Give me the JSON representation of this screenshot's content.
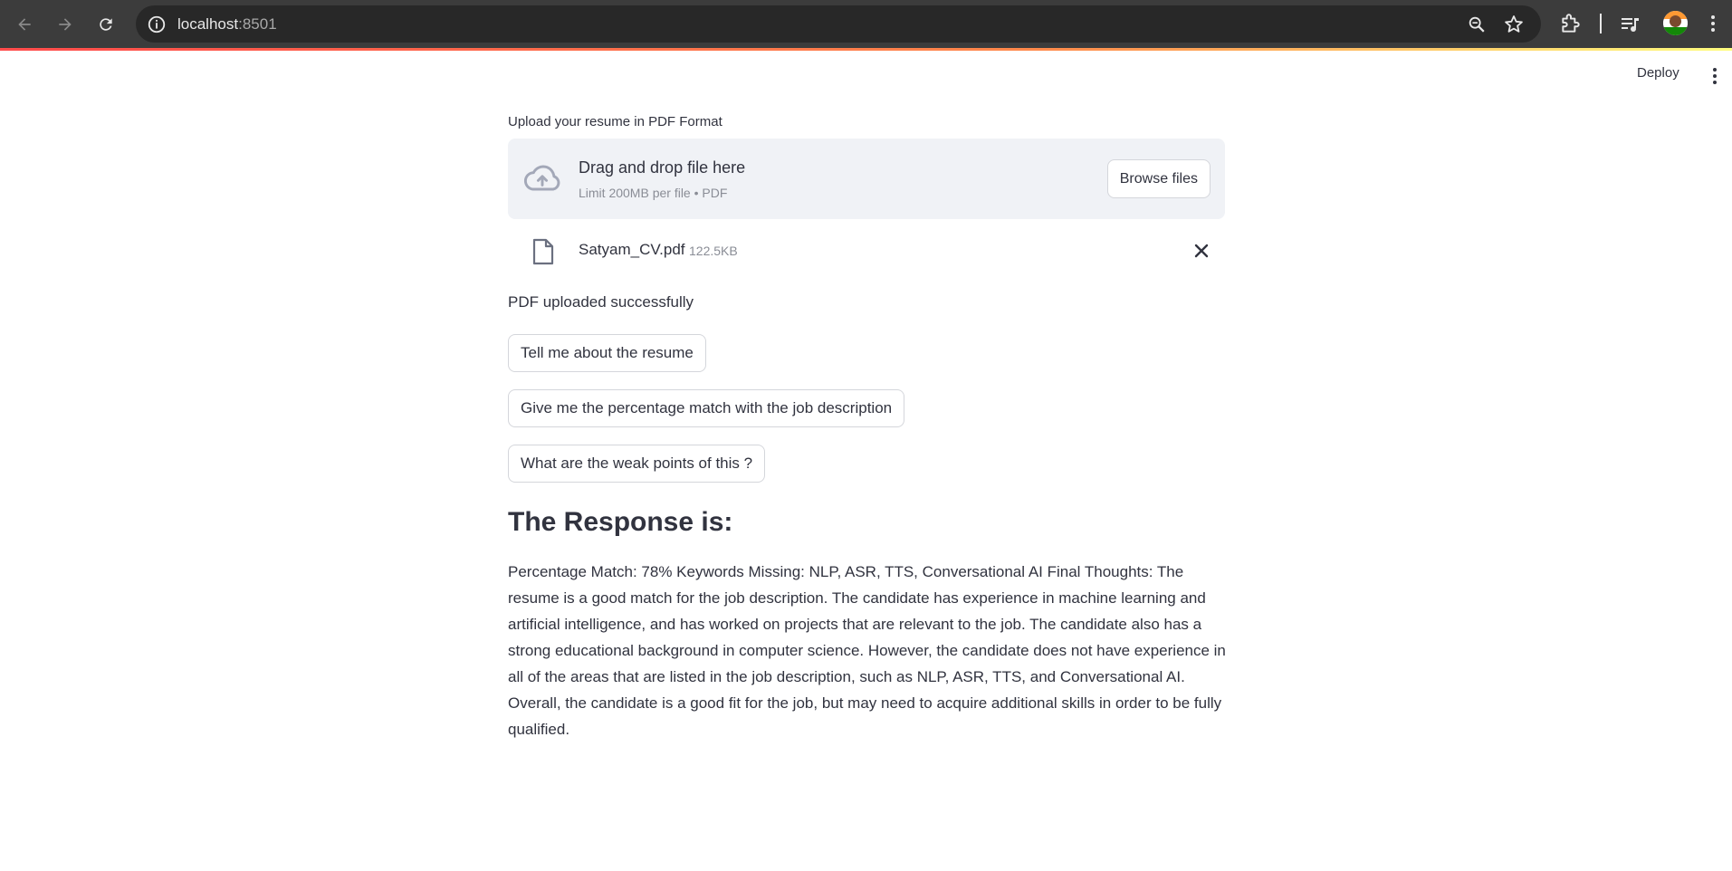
{
  "browser": {
    "url_host": "localhost",
    "url_port": ":8501",
    "icons": [
      "back-arrow-icon",
      "forward-arrow-icon",
      "reload-icon",
      "site-info-icon",
      "zoom-icon",
      "bookmark-star-icon",
      "extensions-icon",
      "media-control-icon",
      "profile-avatar",
      "more-menu-icon"
    ]
  },
  "header": {
    "deploy_label": "Deploy"
  },
  "uploader": {
    "label": "Upload your resume in PDF Format",
    "drop_title": "Drag and drop file here",
    "limit_text": "Limit 200MB per file • PDF",
    "browse_label": "Browse files"
  },
  "file": {
    "name": "Satyam_CV.pdf",
    "size": "122.5KB"
  },
  "status": {
    "message": "PDF uploaded successfully"
  },
  "actions": {
    "about_label": "Tell me about the resume",
    "match_label": "Give me the percentage match with the job description",
    "weak_label": "What are the weak points of this ?"
  },
  "response": {
    "heading": "The Response is:",
    "text": "Percentage Match: 78% Keywords Missing: NLP, ASR, TTS, Conversational AI Final Thoughts: The resume is a good match for the job description. The candidate has experience in machine learning and artificial intelligence, and has worked on projects that are relevant to the job. The candidate also has a strong educational background in computer science. However, the candidate does not have experience in all of the areas that are listed in the job description, such as NLP, ASR, TTS, and Conversational AI. Overall, the candidate is a good fit for the job, but may need to acquire additional skills in order to be fully qualified."
  },
  "colors": {
    "chrome_bg": "#3c3c3c",
    "dropzone_bg": "#f0f2f6",
    "text": "#31333f",
    "muted_text": "#8a8d96",
    "accent_gradient_start": "#ff4b4b",
    "accent_gradient_end": "#fffd80"
  }
}
